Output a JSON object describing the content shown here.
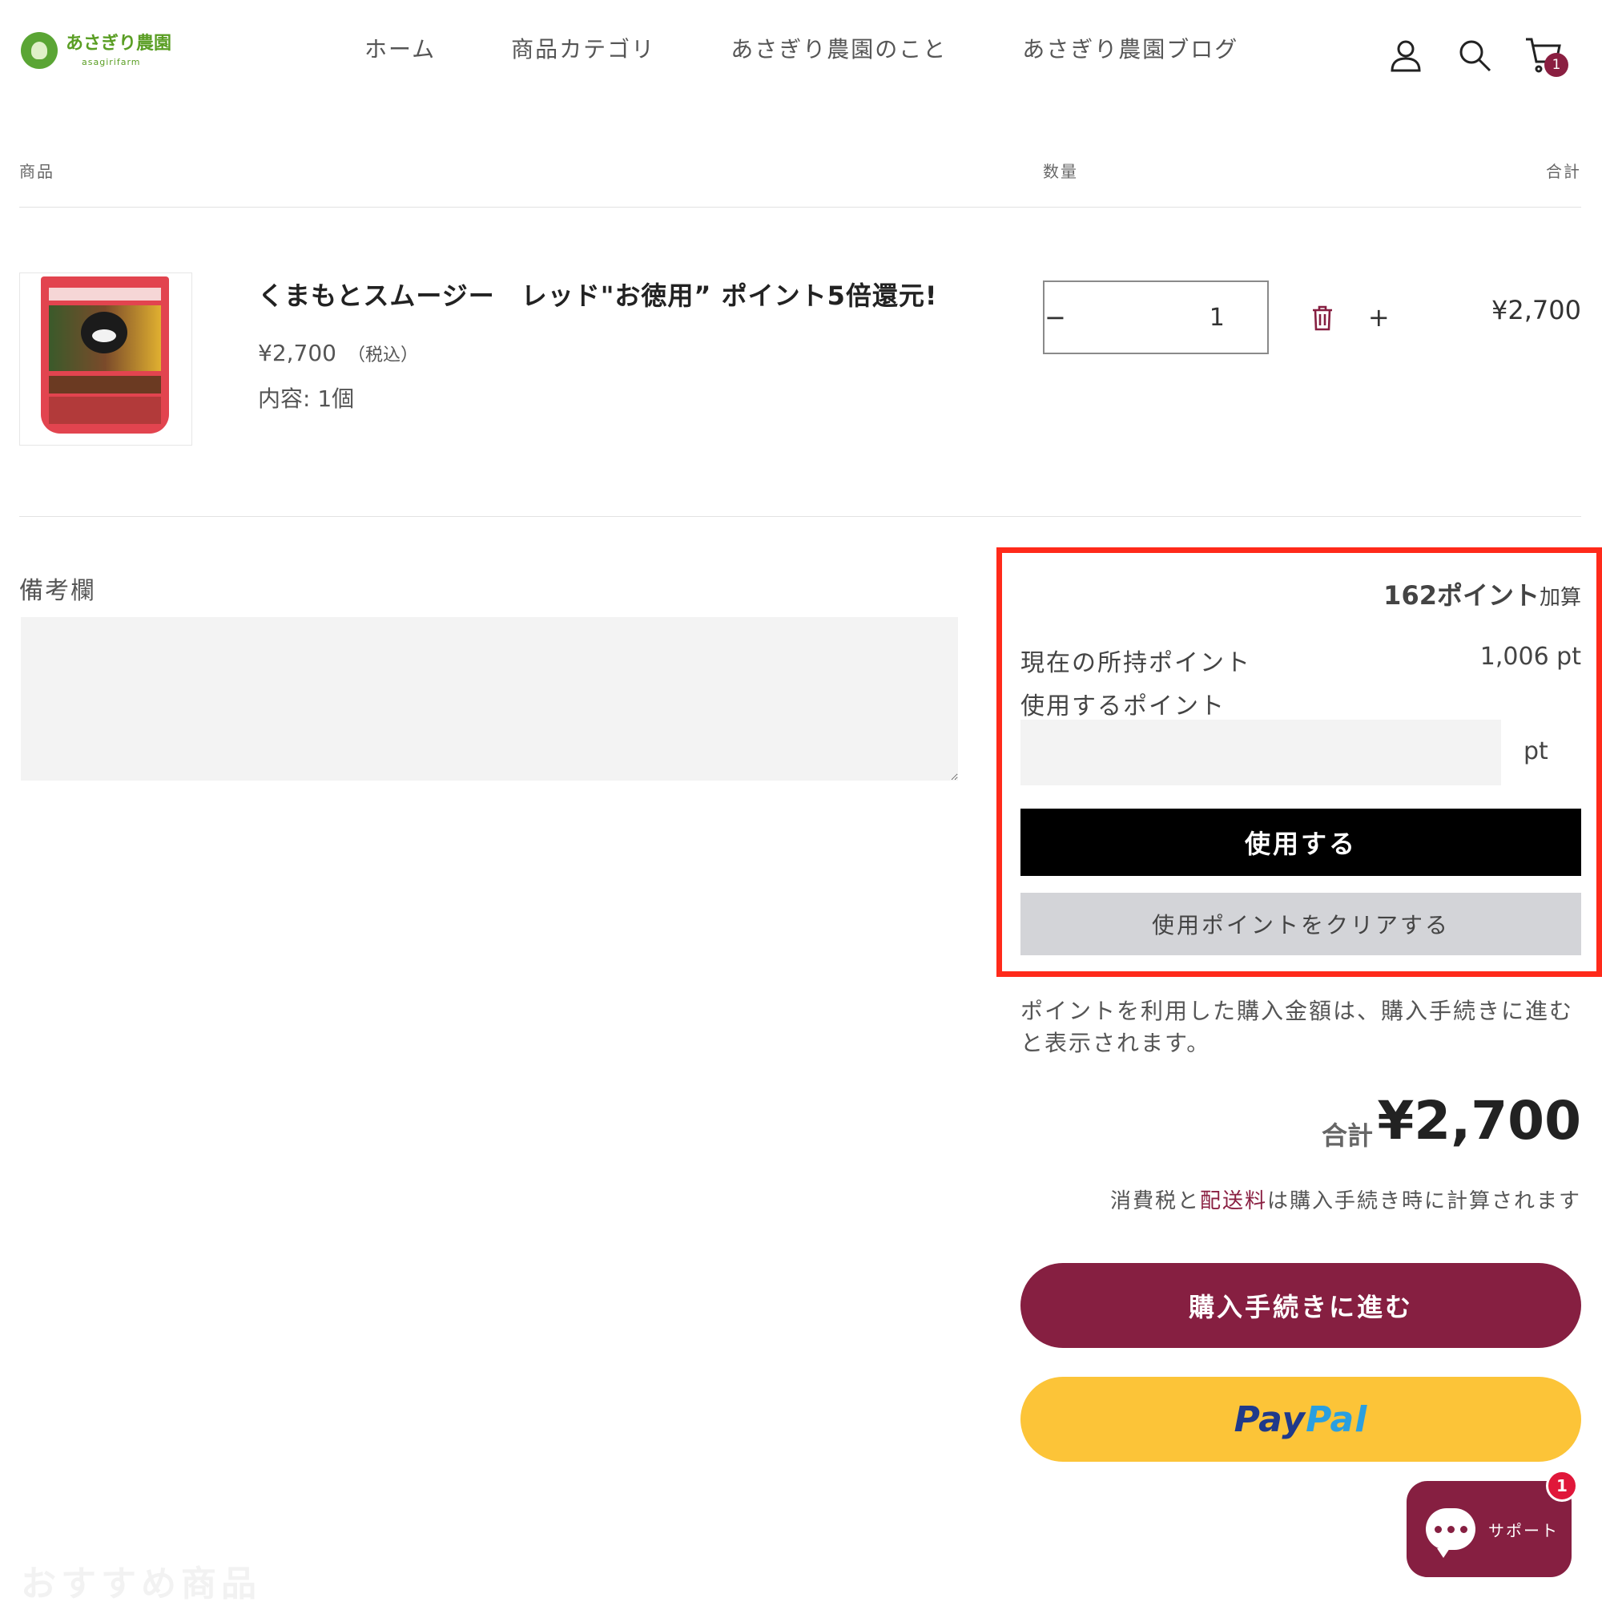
{
  "header": {
    "logo_jp": "あさぎり農園",
    "logo_en": "asagirifarm",
    "nav": [
      "ホーム",
      "商品カテゴリ",
      "あさぎり農園のこと",
      "あさぎり農園ブログ"
    ],
    "cart_count": "1",
    "icons": [
      "account-icon",
      "search-icon",
      "cart-icon"
    ]
  },
  "table": {
    "col_product": "商品",
    "col_qty": "数量",
    "col_total": "合計"
  },
  "item": {
    "title": "くまもとスムージー　レッド\"お徳用” ポイント5倍還元!",
    "price": "¥2,700",
    "tax_note": "（税込）",
    "variant": "内容: 1個",
    "quantity": "1",
    "line_total": "¥2,700"
  },
  "note": {
    "label": "備考欄"
  },
  "points": {
    "add_number": "162ポイント",
    "add_suffix": "加算",
    "current_label": "現在の所持ポイント",
    "current_value": "1,006 pt",
    "use_label": "使用するポイント",
    "unit": "pt",
    "use_button": "使用する",
    "clear_button": "使用ポイントをクリアする",
    "notice": "ポイントを利用した購入金額は、購入手続きに進むと表示されます。"
  },
  "summary": {
    "total_label": "合計",
    "total_value": "¥2,700",
    "tax_pre": "消費税と",
    "tax_link": "配送料",
    "tax_post": "は購入手続き時に計算されます",
    "checkout": "購入手続きに進む",
    "paypal_a": "Pay",
    "paypal_b": "Pal"
  },
  "chat": {
    "label": "サポート",
    "badge": "1"
  },
  "recommend": {
    "heading": "おすすめ商品"
  },
  "colors": {
    "brand": "#861f41",
    "highlight_border": "#ff2a1a",
    "paypal_yellow": "#fcc438",
    "logo_green": "#5aa534"
  }
}
